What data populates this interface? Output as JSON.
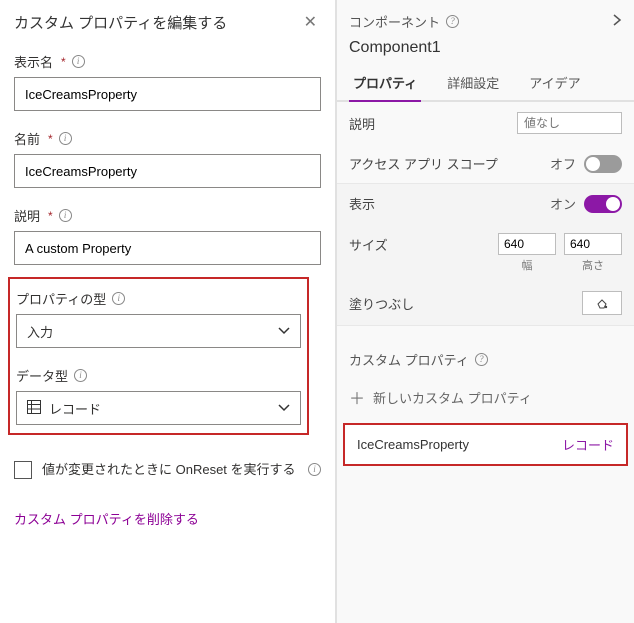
{
  "left": {
    "title": "カスタム プロパティを編集する",
    "displayName": {
      "label": "表示名",
      "value": "IceCreamsProperty"
    },
    "name": {
      "label": "名前",
      "value": "IceCreamsProperty"
    },
    "description": {
      "label": "説明",
      "value": "A custom Property"
    },
    "propertyType": {
      "label": "プロパティの型",
      "value": "入力"
    },
    "dataType": {
      "label": "データ型",
      "value": "レコード"
    },
    "onReset": {
      "label": "値が変更されたときに OnReset を実行する"
    },
    "deleteLink": "カスタム プロパティを削除する"
  },
  "right": {
    "headerLabel": "コンポーネント",
    "componentName": "Component1",
    "tabs": {
      "properties": "プロパティ",
      "advanced": "詳細設定",
      "ideas": "アイデア"
    },
    "desc": {
      "label": "説明",
      "placeholder": "値なし"
    },
    "accessScope": {
      "label": "アクセス アプリ スコープ",
      "state": "オフ"
    },
    "display": {
      "label": "表示",
      "state": "オン"
    },
    "size": {
      "label": "サイズ",
      "width": "640",
      "height": "640",
      "widthLabel": "幅",
      "heightLabel": "高さ"
    },
    "fill": {
      "label": "塗りつぶし"
    },
    "customProps": {
      "header": "カスタム プロパティ",
      "newLabel": "新しいカスタム プロパティ"
    },
    "propItem": {
      "name": "IceCreamsProperty",
      "type": "レコード"
    }
  }
}
